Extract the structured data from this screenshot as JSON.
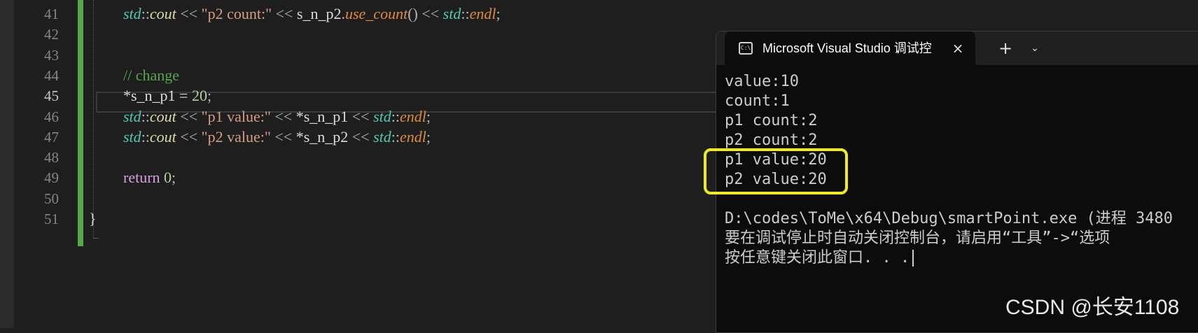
{
  "editor": {
    "line_numbers": [
      "41",
      "42",
      "43",
      "44",
      "45",
      "46",
      "47",
      "48",
      "49",
      "50",
      "51"
    ],
    "current_line": "45",
    "lines": [
      [
        {
          "t": "std",
          "c": "ns"
        },
        {
          "t": "::",
          "c": "op"
        },
        {
          "t": "cout",
          "c": "fn"
        },
        {
          "t": " << ",
          "c": "op"
        },
        {
          "t": "\"p2 count:\"",
          "c": "str"
        },
        {
          "t": " << ",
          "c": "op"
        },
        {
          "t": "s_n_p2",
          "c": "var"
        },
        {
          "t": ".",
          "c": "op"
        },
        {
          "t": "use_count",
          "c": "endl"
        },
        {
          "t": "() << ",
          "c": "op"
        },
        {
          "t": "std",
          "c": "ns"
        },
        {
          "t": "::",
          "c": "op"
        },
        {
          "t": "endl",
          "c": "endl"
        },
        {
          "t": ";",
          "c": "op"
        }
      ],
      [],
      [],
      [
        {
          "t": "// change",
          "c": "cm"
        }
      ],
      [
        {
          "t": "*s_n_p1 = ",
          "c": "var"
        },
        {
          "t": "20",
          "c": "num"
        },
        {
          "t": ";",
          "c": "op"
        }
      ],
      [
        {
          "t": "std",
          "c": "ns"
        },
        {
          "t": "::",
          "c": "op"
        },
        {
          "t": "cout",
          "c": "fn"
        },
        {
          "t": " << ",
          "c": "op"
        },
        {
          "t": "\"p1 value:\"",
          "c": "str"
        },
        {
          "t": " << ",
          "c": "op"
        },
        {
          "t": "*s_n_p1",
          "c": "var"
        },
        {
          "t": " << ",
          "c": "op"
        },
        {
          "t": "std",
          "c": "ns"
        },
        {
          "t": "::",
          "c": "op"
        },
        {
          "t": "endl",
          "c": "endl"
        },
        {
          "t": ";",
          "c": "op"
        }
      ],
      [
        {
          "t": "std",
          "c": "ns"
        },
        {
          "t": "::",
          "c": "op"
        },
        {
          "t": "cout",
          "c": "fn"
        },
        {
          "t": " << ",
          "c": "op"
        },
        {
          "t": "\"p2 value:\"",
          "c": "str"
        },
        {
          "t": " << ",
          "c": "op"
        },
        {
          "t": "*s_n_p2",
          "c": "var"
        },
        {
          "t": " << ",
          "c": "op"
        },
        {
          "t": "std",
          "c": "ns"
        },
        {
          "t": "::",
          "c": "op"
        },
        {
          "t": "endl",
          "c": "endl"
        },
        {
          "t": ";",
          "c": "op"
        }
      ],
      [],
      [
        {
          "t": "return ",
          "c": "kw"
        },
        {
          "t": "0",
          "c": "num"
        },
        {
          "t": ";",
          "c": "op"
        }
      ],
      [],
      [
        {
          "t": "}",
          "c": "var"
        }
      ]
    ]
  },
  "console": {
    "tab_title": "Microsoft Visual Studio 调试控",
    "close_icon": "×",
    "new_tab_icon": "+",
    "menu_icon": "⌄",
    "output": [
      "value:10",
      "count:1",
      "p1 count:2",
      "p2 count:2",
      "p1 value:20",
      "p2 value:20",
      "",
      "D:\\codes\\ToMe\\x64\\Debug\\smartPoint.exe (进程 3480",
      "要在调试停止时自动关闭控制台，请启用“工具”->“选项",
      "按任意键关闭此窗口. . ."
    ],
    "highlight_color": "#f2ea1b"
  },
  "watermark": "CSDN @长安1108"
}
